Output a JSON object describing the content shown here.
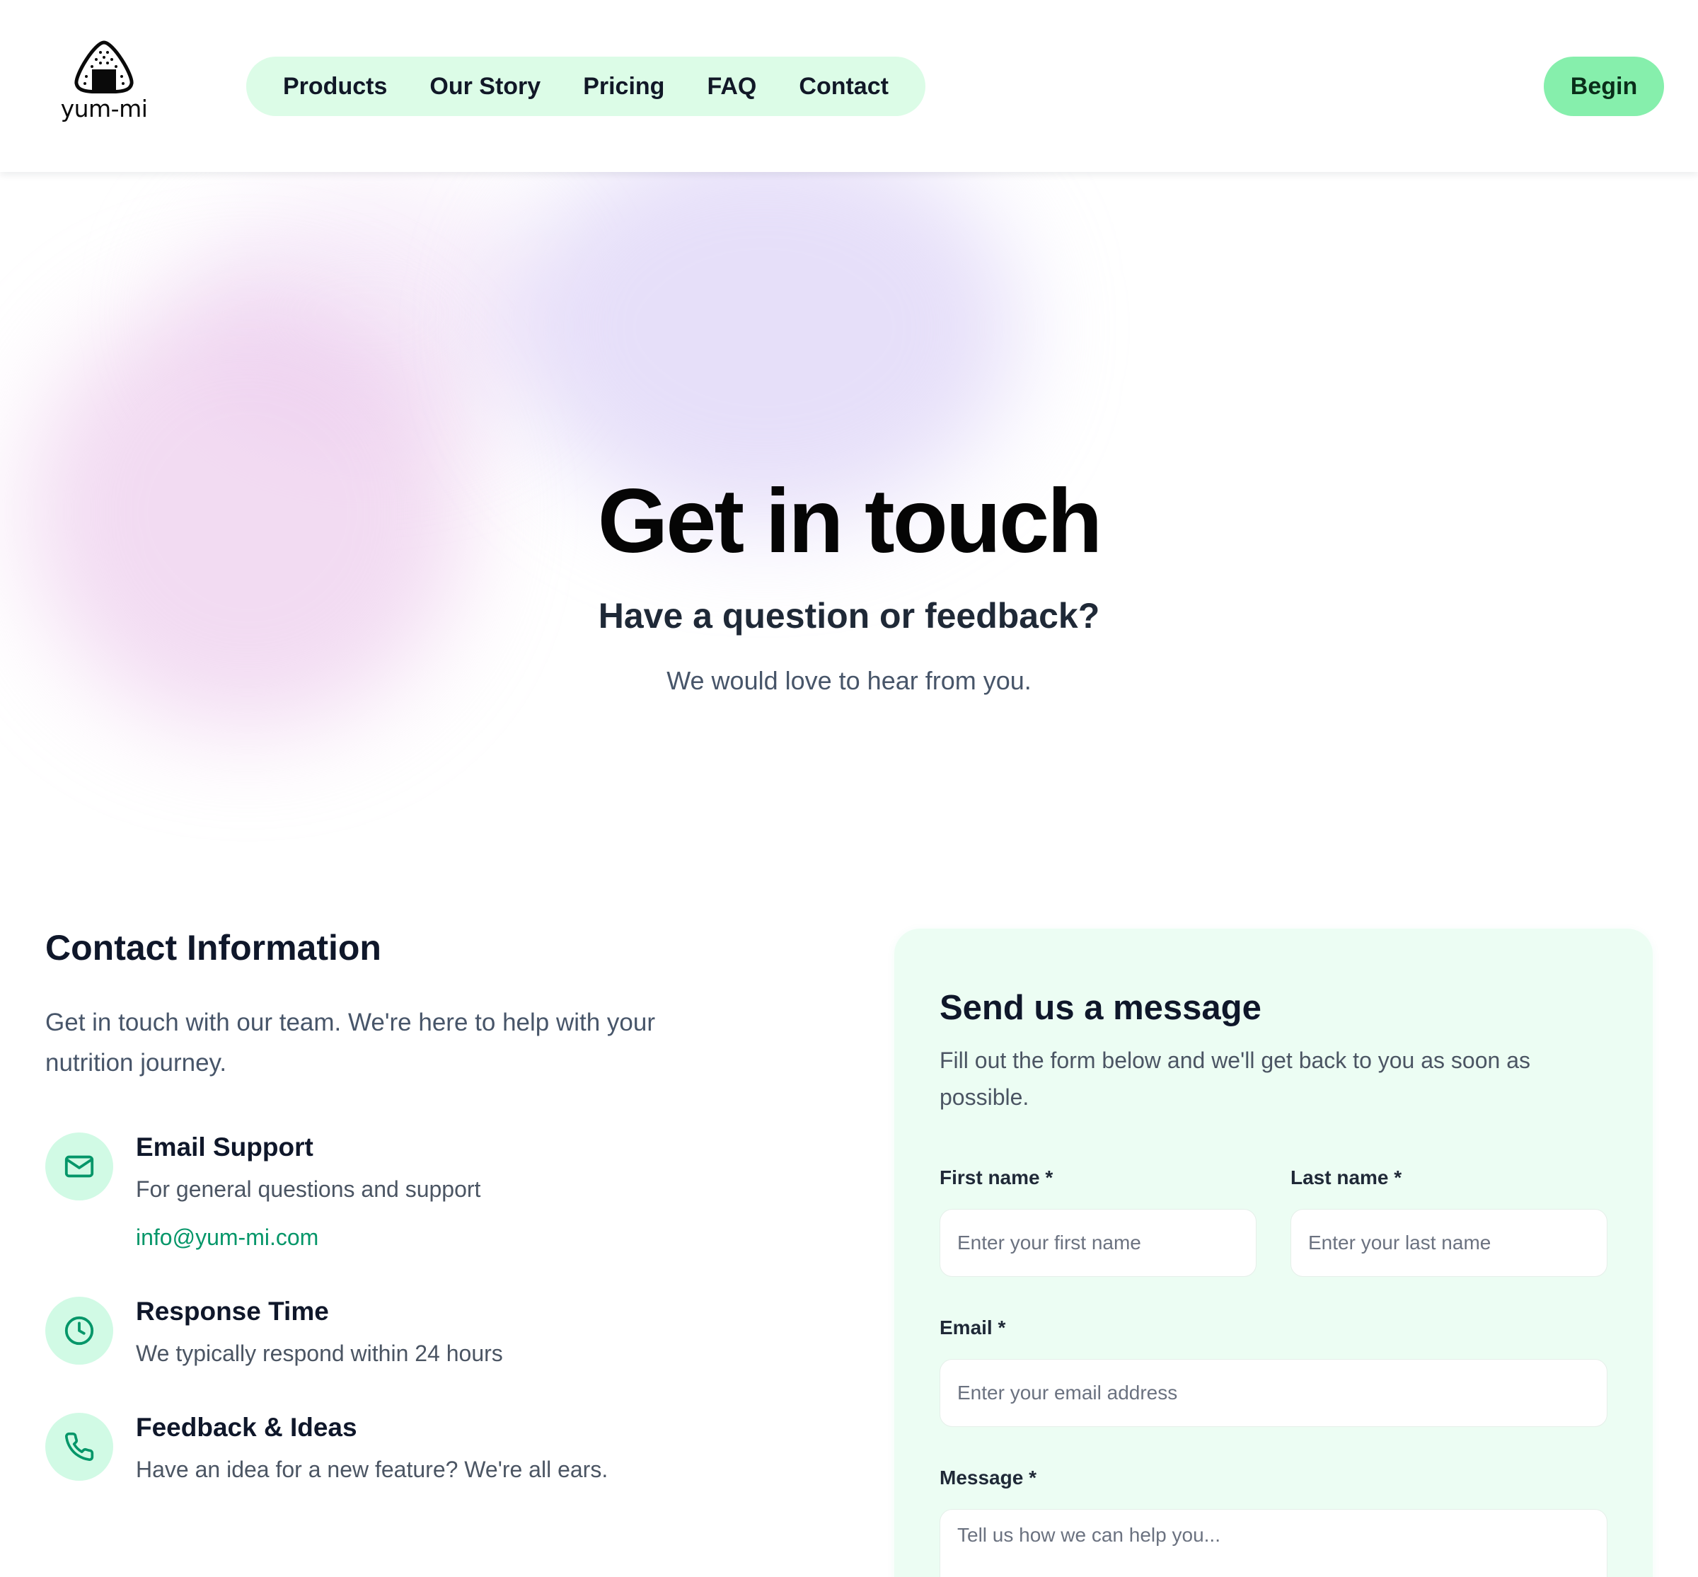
{
  "brand": {
    "name": "yum-mi",
    "logo_icon": "onigiri-icon"
  },
  "nav": {
    "items": [
      "Products",
      "Our Story",
      "Pricing",
      "FAQ",
      "Contact"
    ]
  },
  "header": {
    "cta_label": "Begin"
  },
  "hero": {
    "title": "Get in touch",
    "subtitle": "Have a question or feedback?",
    "description": "We would love to hear from you."
  },
  "contact_info": {
    "title": "Contact Information",
    "description": "Get in touch with our team. We're here to help with your nutrition journey.",
    "items": [
      {
        "icon": "mail-icon",
        "title": "Email Support",
        "description": "For general questions and support",
        "link": "info@yum-mi.com"
      },
      {
        "icon": "clock-icon",
        "title": "Response Time",
        "description": "We typically respond within 24 hours"
      },
      {
        "icon": "phone-icon",
        "title": "Feedback & Ideas",
        "description": "Have an idea for a new feature? We're all ears."
      }
    ]
  },
  "form": {
    "title": "Send us a message",
    "description": "Fill out the form below and we'll get back to you as soon as possible.",
    "first_name": {
      "label": "First name *",
      "placeholder": "Enter your first name",
      "value": ""
    },
    "last_name": {
      "label": "Last name *",
      "placeholder": "Enter your last name",
      "value": ""
    },
    "email": {
      "label": "Email *",
      "placeholder": "Enter your email address",
      "value": ""
    },
    "message": {
      "label": "Message *",
      "placeholder": "Tell us how we can help you...",
      "value": ""
    }
  },
  "colors": {
    "accent": "#86efac",
    "nav_bg": "#dcfce7",
    "card_bg": "#ecfdf3",
    "link": "#059669",
    "icon_bg": "#d1fae5"
  }
}
